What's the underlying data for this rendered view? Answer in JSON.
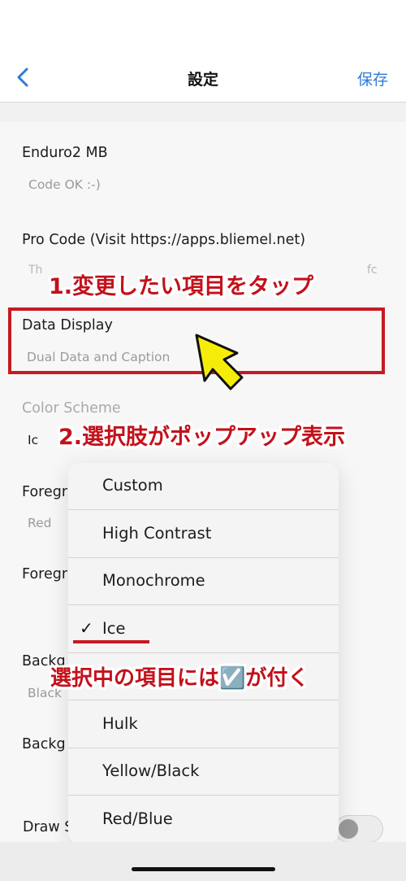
{
  "nav": {
    "title": "設定",
    "save_label": "保存"
  },
  "fields": [
    {
      "label": "Enduro2 MB",
      "value": "Code OK :-)"
    },
    {
      "label": "Pro Code (Visit https://apps.bliemel.net)",
      "value": "Th",
      "value_tail": "fc"
    },
    {
      "label": "Data Display",
      "value": "Dual Data and Caption"
    },
    {
      "label": "Color Scheme",
      "value": "Ic"
    },
    {
      "label": "Foregr",
      "value": "Red"
    },
    {
      "label": "Foregr"
    },
    {
      "label": "Backg",
      "value": "Black"
    },
    {
      "label": "Backg"
    },
    {
      "label": "Draw S"
    }
  ],
  "annotations": {
    "step1": "1.変更したい項目をタップ",
    "step2": "2.選択肢がポップアップ表示",
    "step3": "選択中の項目には☑️が付く"
  },
  "popup": {
    "items": [
      "Custom",
      "High Contrast",
      "Monochrome",
      "Ice",
      "",
      "Hulk",
      "Yellow/Black",
      "Red/Blue"
    ],
    "selected_index": 3,
    "check_mark": "✓"
  },
  "colors": {
    "accent": "#2f7bd8",
    "annotation": "#c3111b",
    "arrow": "#f5ec0a"
  }
}
